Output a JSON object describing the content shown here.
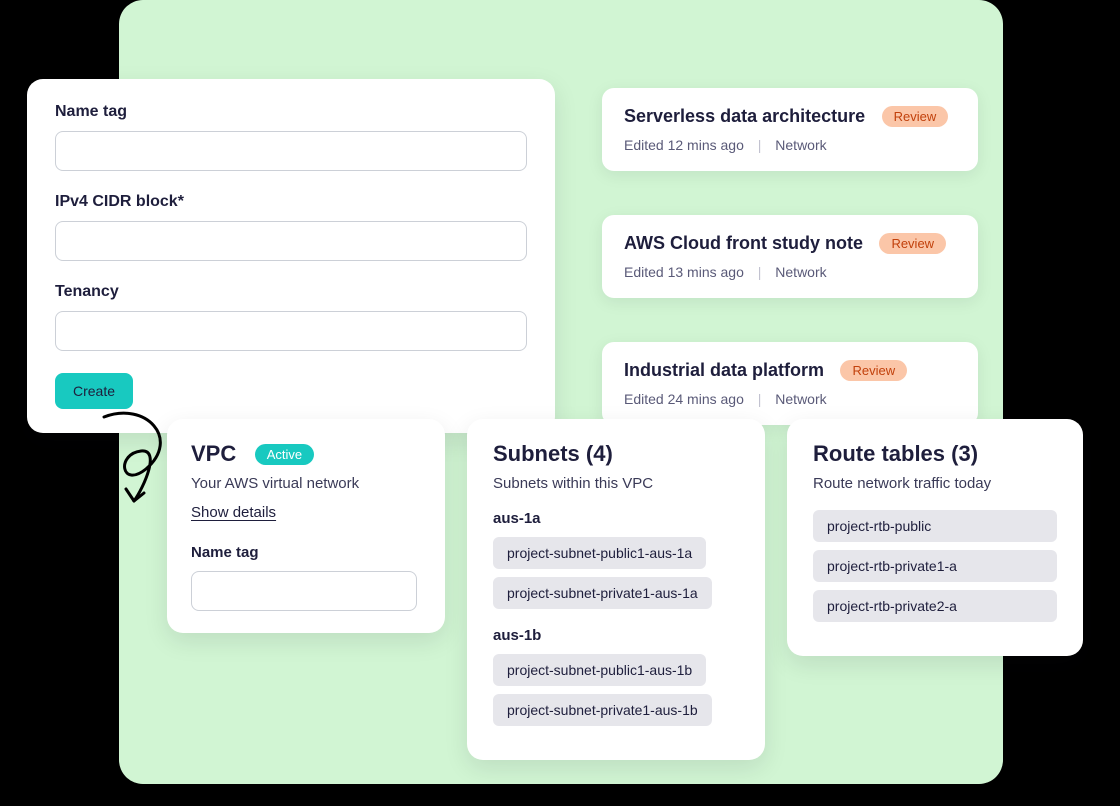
{
  "form": {
    "name_tag_label": "Name tag",
    "cidr_label": "IPv4 CIDR block*",
    "tenancy_label": "Tenancy",
    "create_button": "Create"
  },
  "activity": [
    {
      "title": "Serverless data architecture",
      "badge": "Review",
      "edited": "Edited 12 mins ago",
      "category": "Network"
    },
    {
      "title": "AWS Cloud front study note",
      "badge": "Review",
      "edited": "Edited 13 mins ago",
      "category": "Network"
    },
    {
      "title": "Industrial data platform",
      "badge": "Review",
      "edited": "Edited 24 mins ago",
      "category": "Network"
    }
  ],
  "vpc": {
    "title": "VPC",
    "status": "Active",
    "description": "Your AWS virtual network",
    "details_link": "Show details",
    "name_tag_label": "Name tag"
  },
  "subnets": {
    "title": "Subnets (4)",
    "subtitle": "Subnets within this VPC",
    "groups": [
      {
        "zone": "aus-1a",
        "items": [
          "project-subnet-public1-aus-1a",
          "project-subnet-private1-aus-1a"
        ]
      },
      {
        "zone": "aus-1b",
        "items": [
          "project-subnet-public1-aus-1b",
          "project-subnet-private1-aus-1b"
        ]
      }
    ]
  },
  "route_tables": {
    "title": "Route tables (3)",
    "subtitle": "Route network traffic today",
    "items": [
      "project-rtb-public",
      "project-rtb-private1-a",
      "project-rtb-private2-a"
    ]
  }
}
